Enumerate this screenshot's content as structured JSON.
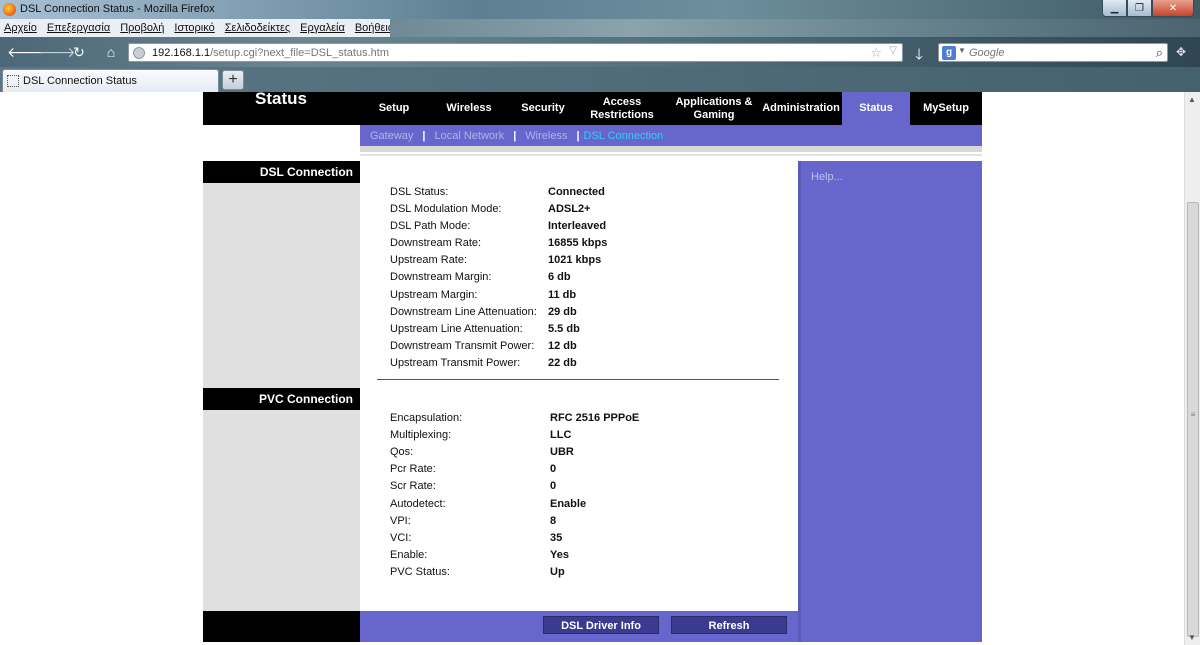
{
  "window": {
    "title": "DSL Connection Status - Mozilla Firefox"
  },
  "menu": [
    "Αρχείο",
    "Επεξεργασία",
    "Προβολή",
    "Ιστορικό",
    "Σελιδοδείκτες",
    "Εργαλεία",
    "Βοήθεια"
  ],
  "urlbar": {
    "host": "192.168.1.1",
    "path": "/setup.cgi?next_file=DSL_status.htm"
  },
  "search": {
    "placeholder": "Google",
    "engine_icon": "google-icon"
  },
  "tab": {
    "label": "DSL Connection Status",
    "newtab": "+"
  },
  "router": {
    "page_title": "Status",
    "tabs": [
      {
        "label": "Setup",
        "active": false
      },
      {
        "label": "Wireless",
        "active": false
      },
      {
        "label": "Security",
        "active": false
      },
      {
        "label": "Access Restrictions",
        "active": false
      },
      {
        "label": "Applications & Gaming",
        "active": false
      },
      {
        "label": "Administration",
        "active": false
      },
      {
        "label": "Status",
        "active": true
      },
      {
        "label": "MySetup",
        "active": false
      }
    ],
    "subnav": [
      {
        "label": "Gateway",
        "current": false
      },
      {
        "label": "Local Network",
        "current": false
      },
      {
        "label": "Wireless",
        "current": false
      },
      {
        "label": "DSL Connection",
        "current": true
      }
    ],
    "sep": "|",
    "help": "Help...",
    "dsl_section": "DSL Connection",
    "pvc_section": "PVC Connection",
    "dsl": [
      {
        "label": "DSL Status:",
        "value": "Connected"
      },
      {
        "label": "DSL Modulation Mode:",
        "value": "ADSL2+"
      },
      {
        "label": "DSL Path Mode:",
        "value": "Interleaved"
      },
      {
        "label": "Downstream Rate:",
        "value": "16855 kbps"
      },
      {
        "label": "Upstream Rate:",
        "value": "1021 kbps"
      },
      {
        "label": "Downstream Margin:",
        "value": "6 db"
      },
      {
        "label": "Upstream Margin:",
        "value": "11 db"
      },
      {
        "label": "Downstream Line Attenuation:",
        "value": "29 db"
      },
      {
        "label": "Upstream Line Attenuation:",
        "value": "5.5 db"
      },
      {
        "label": "Downstream Transmit Power:",
        "value": "12 db"
      },
      {
        "label": "Upstream Transmit Power:",
        "value": "22 db"
      }
    ],
    "pvc": [
      {
        "label": "Encapsulation:",
        "value": "RFC 2516 PPPoE"
      },
      {
        "label": "Multiplexing:",
        "value": "LLC"
      },
      {
        "label": "Qos:",
        "value": "UBR"
      },
      {
        "label": "Pcr Rate:",
        "value": "0"
      },
      {
        "label": "Scr Rate:",
        "value": "0"
      },
      {
        "label": "Autodetect:",
        "value": "Enable"
      },
      {
        "label": "VPI:",
        "value": "8"
      },
      {
        "label": "VCI:",
        "value": "35"
      },
      {
        "label": "Enable:",
        "value": "Yes"
      },
      {
        "label": "PVC Status:",
        "value": "Up"
      }
    ],
    "buttons": {
      "driver_info": "DSL Driver Info",
      "refresh": "Refresh"
    }
  }
}
